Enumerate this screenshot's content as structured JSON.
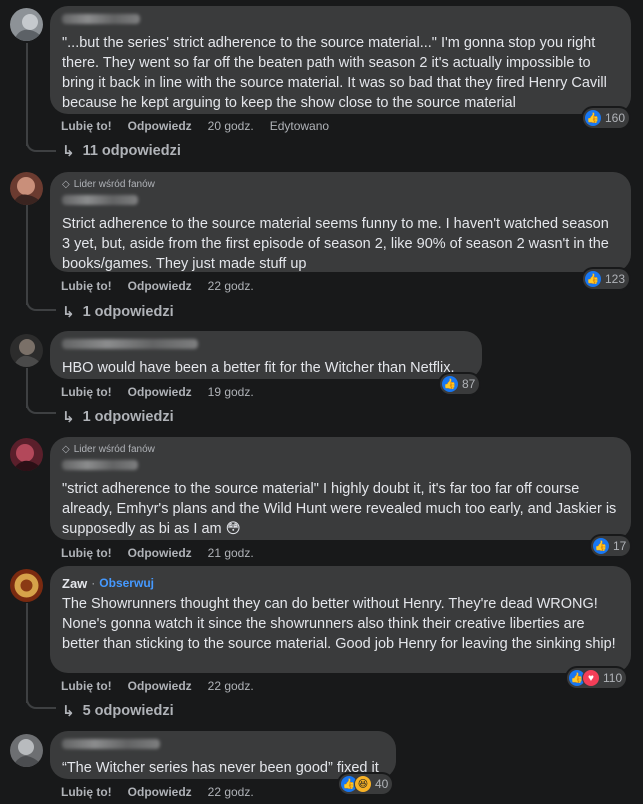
{
  "actions": {
    "like": "Lubię to!",
    "reply": "Odpowiedz",
    "follow": "Obserwuj",
    "separator": "·"
  },
  "badge_label": "Lider wśród fanów",
  "comments": [
    {
      "text": "\"...but the series' strict adherence to the source material...\" I'm gonna stop you right there. They went so far off the beaten path with season 2 it's actually impossible to bring it back in line with the source material. It was so bad that they fired Henry Cavill because he kept arguing to keep the show close to the source material",
      "reaction_count": "160",
      "reactions": [
        "like"
      ],
      "time": "20 godz.",
      "edited": "Edytowano",
      "replies": "11 odpowiedzi"
    },
    {
      "text": "Strict adherence to the source material seems funny to me. I haven't watched season 3 yet, but, aside from the first episode of season 2, like 90% of season 2 wasn't in the books/games. They just made stuff up",
      "reaction_count": "123",
      "reactions": [
        "like"
      ],
      "time": "22 godz.",
      "replies": "1 odpowiedzi"
    },
    {
      "text": "HBO would have been a better fit for the Witcher than Netflix.",
      "reaction_count": "87",
      "reactions": [
        "like"
      ],
      "time": "19 godz.",
      "replies": "1 odpowiedzi"
    },
    {
      "text": "\"strict adherence to the source material\" I highly doubt it, it's far too far off course already, Emhyr's plans and the Wild Hunt were revealed much too early, and Jaskier is supposedly as bi as I am 😳",
      "reaction_count": "17",
      "reactions": [
        "like"
      ],
      "time": "21 godz."
    },
    {
      "author": "Zaw",
      "text": "The Showrunners thought they can do better without Henry. They're dead WRONG! None's gonna watch it since the showrunners also think their creative liberties are better than sticking to the source material. Good job Henry for leaving the sinking ship!",
      "reaction_count": "110",
      "reactions": [
        "like",
        "love"
      ],
      "time": "22 godz.",
      "replies": "5 odpowiedzi"
    },
    {
      "text": "“The Witcher series has never been good” fixed it",
      "reaction_count": "40",
      "reactions": [
        "like",
        "haha"
      ],
      "time": "22 godz."
    }
  ],
  "colors": {
    "like": "#1877f2",
    "love": "#f33e58",
    "haha": "#f7b125",
    "follow": "#4599ff"
  }
}
